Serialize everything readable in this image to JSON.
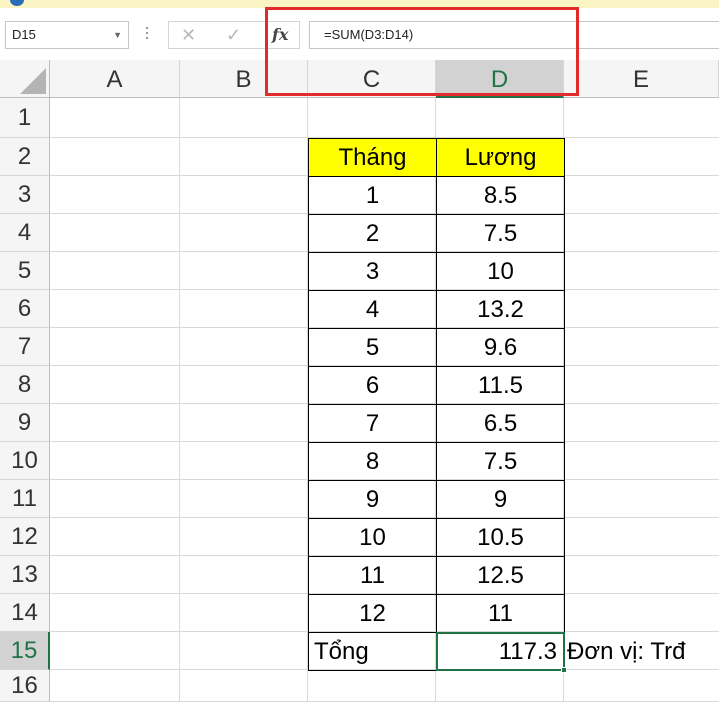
{
  "name_box": {
    "value": "D15"
  },
  "formula_bar": {
    "formula": "=SUM(D3:D14)",
    "fx_label": "fx",
    "cancel_label": "✕",
    "enter_label": "✓"
  },
  "columns": [
    "A",
    "B",
    "C",
    "D",
    "E"
  ],
  "active_column": "D",
  "rows": [
    "1",
    "2",
    "3",
    "4",
    "5",
    "6",
    "7",
    "8",
    "9",
    "10",
    "11",
    "12",
    "13",
    "14",
    "15",
    "16"
  ],
  "active_row": "15",
  "table": {
    "headers": [
      "Tháng",
      "Lương"
    ],
    "data": [
      [
        "1",
        "8.5"
      ],
      [
        "2",
        "7.5"
      ],
      [
        "3",
        "10"
      ],
      [
        "4",
        "13.2"
      ],
      [
        "5",
        "9.6"
      ],
      [
        "6",
        "11.5"
      ],
      [
        "7",
        "6.5"
      ],
      [
        "8",
        "7.5"
      ],
      [
        "9",
        "9"
      ],
      [
        "10",
        "10.5"
      ],
      [
        "11",
        "12.5"
      ],
      [
        "12",
        "11"
      ]
    ],
    "total_label": "Tổng",
    "total_value": "117.3",
    "unit_note": "Đơn vị: Trđ"
  },
  "colors": {
    "header_fill": "#ffff00",
    "active_accent": "#217346",
    "highlight_box": "#e22b2b"
  }
}
